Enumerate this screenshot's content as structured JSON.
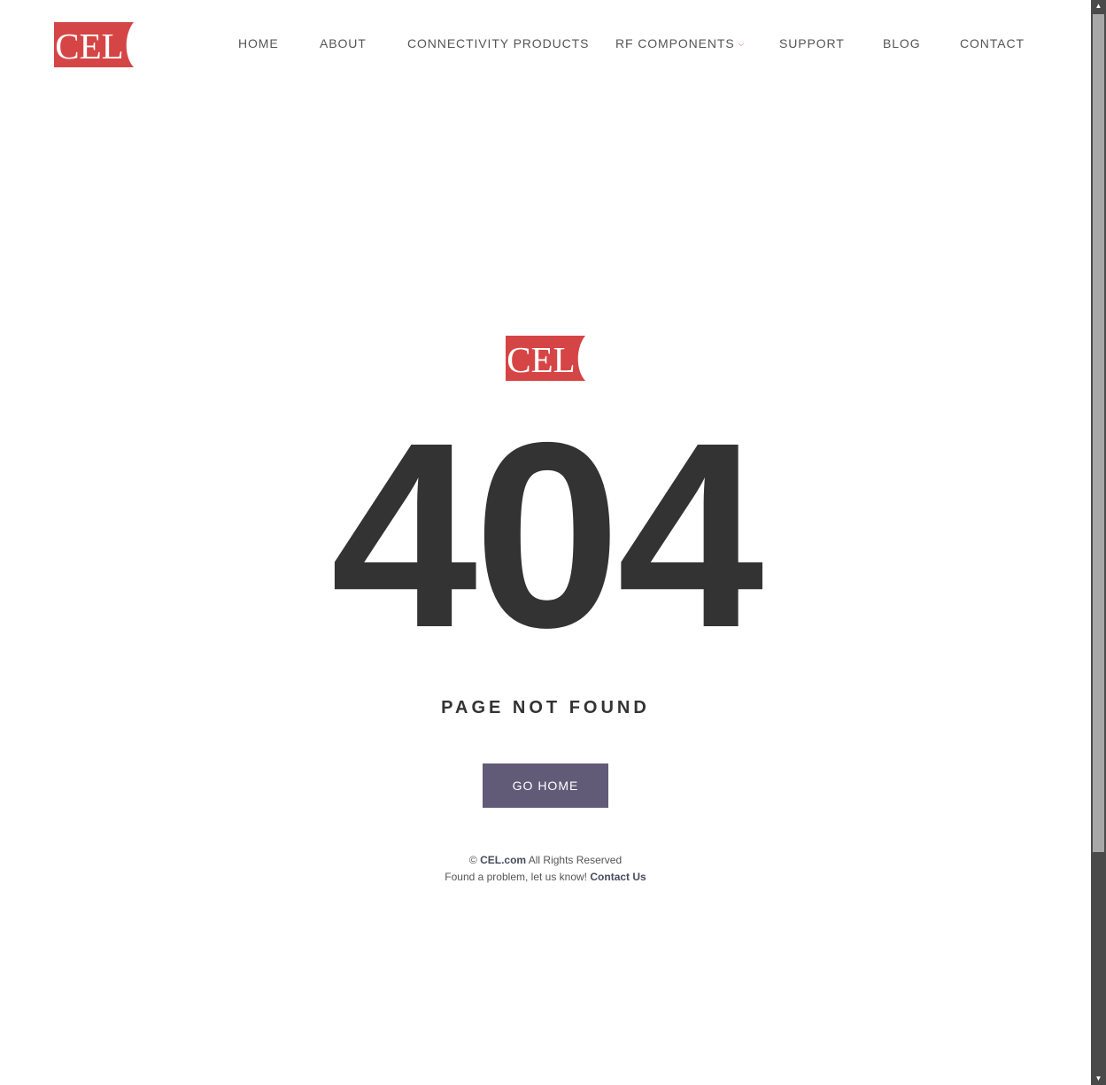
{
  "brand": {
    "logo_text": "CEL",
    "logo_color": "#d64545"
  },
  "nav": {
    "items": [
      {
        "label": "HOME"
      },
      {
        "label": "ABOUT"
      },
      {
        "label": "CONNECTIVITY PRODUCTS"
      },
      {
        "label": "RF COMPONENTS",
        "has_dropdown": true,
        "dropdown_icon": "chevron-down-icon"
      },
      {
        "label": "SUPPORT"
      },
      {
        "label": "BLOG"
      },
      {
        "label": "CONTACT"
      }
    ]
  },
  "error": {
    "code": "404",
    "title": "PAGE NOT FOUND",
    "button_label": "GO HOME"
  },
  "footer": {
    "copyright_symbol": "©",
    "site_name": "CEL.com",
    "rights_text": "All Rights Reserved",
    "problem_text": "Found a problem, let us know!",
    "contact_link": "Contact Us"
  },
  "colors": {
    "button_bg": "#615b78",
    "text_dark": "#333333",
    "accent_red": "#d64545"
  },
  "scrollbar": {
    "up_icon": "scroll-up-arrow-icon",
    "down_icon": "scroll-down-arrow-icon"
  }
}
